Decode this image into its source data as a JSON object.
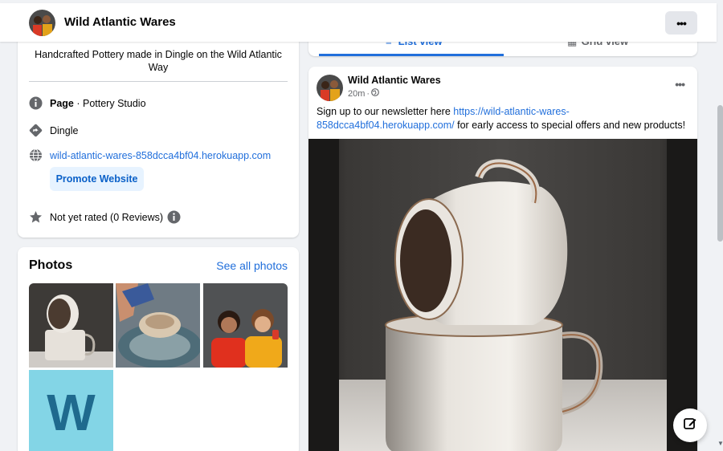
{
  "header": {
    "page_name": "Wild Atlantic Wares",
    "more_icon": "ellipsis-icon"
  },
  "intro": {
    "bio": "Handcrafted Pottery made in Dingle on the Wild Atlantic Way",
    "category_label": "Page",
    "category_value": " · Pottery Studio",
    "location": "Dingle",
    "website": "wild-atlantic-wares-858dcca4bf04.herokuapp.com",
    "promote_label": "Promote Website",
    "rating": "Not yet rated (0 Reviews)"
  },
  "photos": {
    "title": "Photos",
    "see_all": "See all photos",
    "logo_letter": "W"
  },
  "tabs": {
    "list_view": "List view",
    "grid_view": "Grid view"
  },
  "post": {
    "author": "Wild Atlantic Wares",
    "time": "20m",
    "dot": "·",
    "text_before": "Sign up to our newsletter here ",
    "link": "https://wild-atlantic-wares-858dcca4bf04.herokuapp.com/",
    "text_after": " for early access to special offers and new products!"
  },
  "colors": {
    "link": "#216fdb",
    "accent_bg": "#e7f3ff",
    "page_bg": "#f0f2f5"
  }
}
